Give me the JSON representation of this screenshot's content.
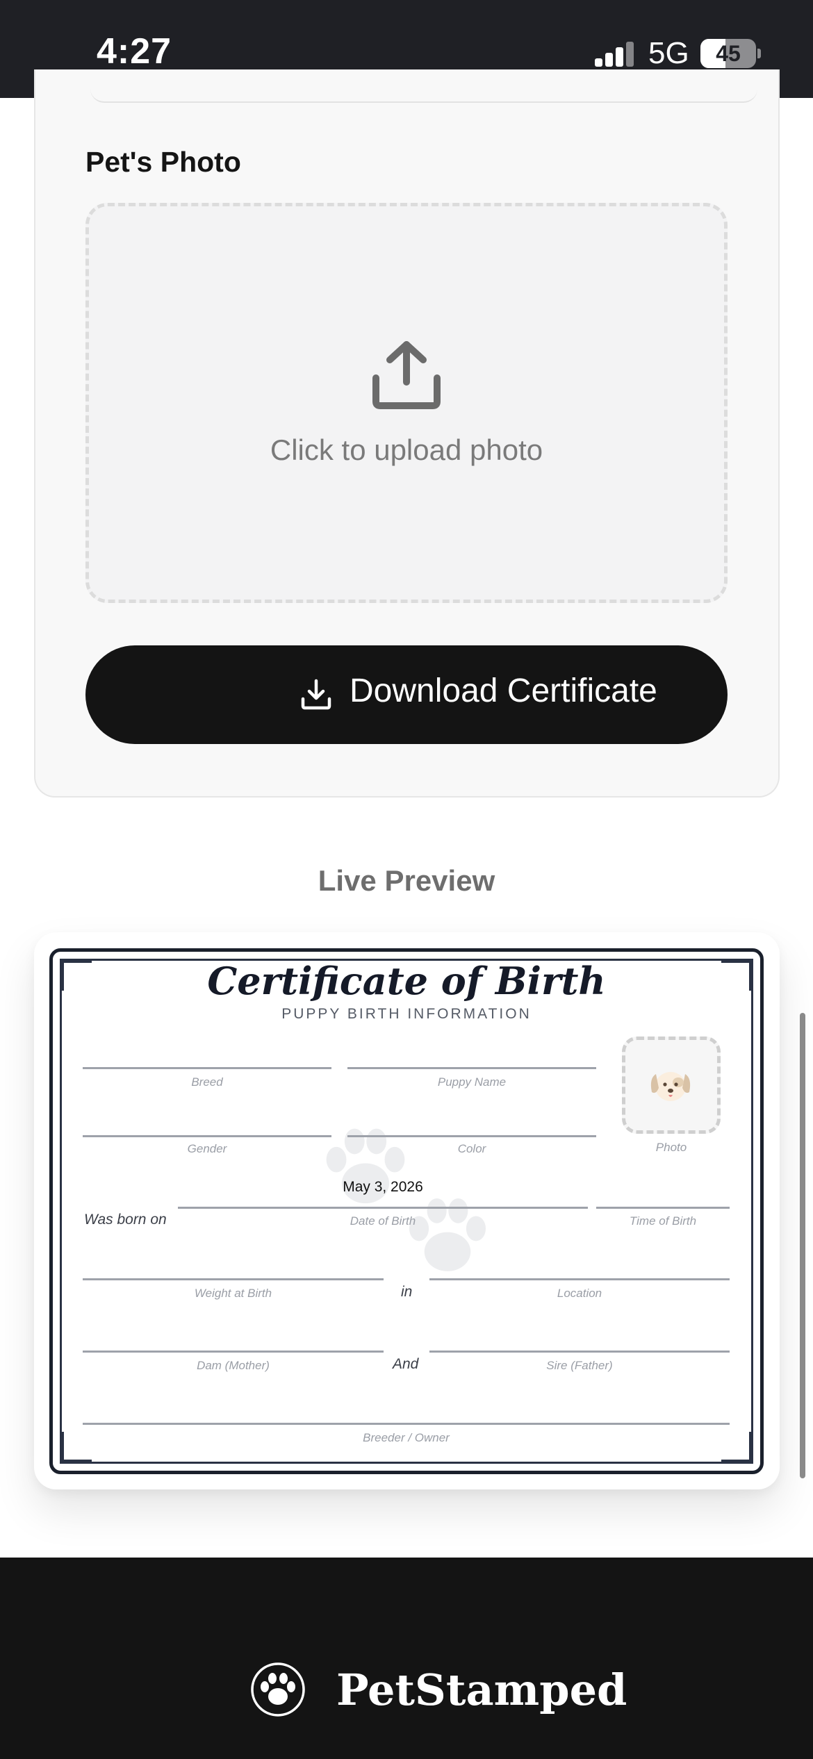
{
  "status_bar": {
    "time": "4:27",
    "network": "5G",
    "battery": "45",
    "battery_level_pct": 45
  },
  "form": {
    "photo_label": "Pet's Photo",
    "upload_text": "Click to upload photo",
    "download_label": "Download Certificate",
    "icons": [
      "upload-icon",
      "download-icon"
    ]
  },
  "preview": {
    "title": "Live Preview",
    "certificate": {
      "title": "Certificate of Birth",
      "subtitle": "PUPPY BIRTH INFORMATION",
      "fields": {
        "breed": "Breed",
        "puppy_name": "Puppy Name",
        "gender": "Gender",
        "color": "Color",
        "photo": "Photo",
        "was_born_on": "Was born on",
        "date_of_birth": "Date of Birth",
        "date_value": "May 3, 2026",
        "time_of_birth": "Time of Birth",
        "weight_at_birth": "Weight at Birth",
        "in": "in",
        "location": "Location",
        "dam": "Dam (Mother)",
        "and": "And",
        "sire": "Sire (Father)",
        "breeder": "Breeder / Owner"
      },
      "colors": {
        "border": "#1a202c",
        "line": "#9ea2aa"
      }
    }
  },
  "footer": {
    "brand": "PetStamped",
    "logo_icon": "paw-badge-icon"
  }
}
